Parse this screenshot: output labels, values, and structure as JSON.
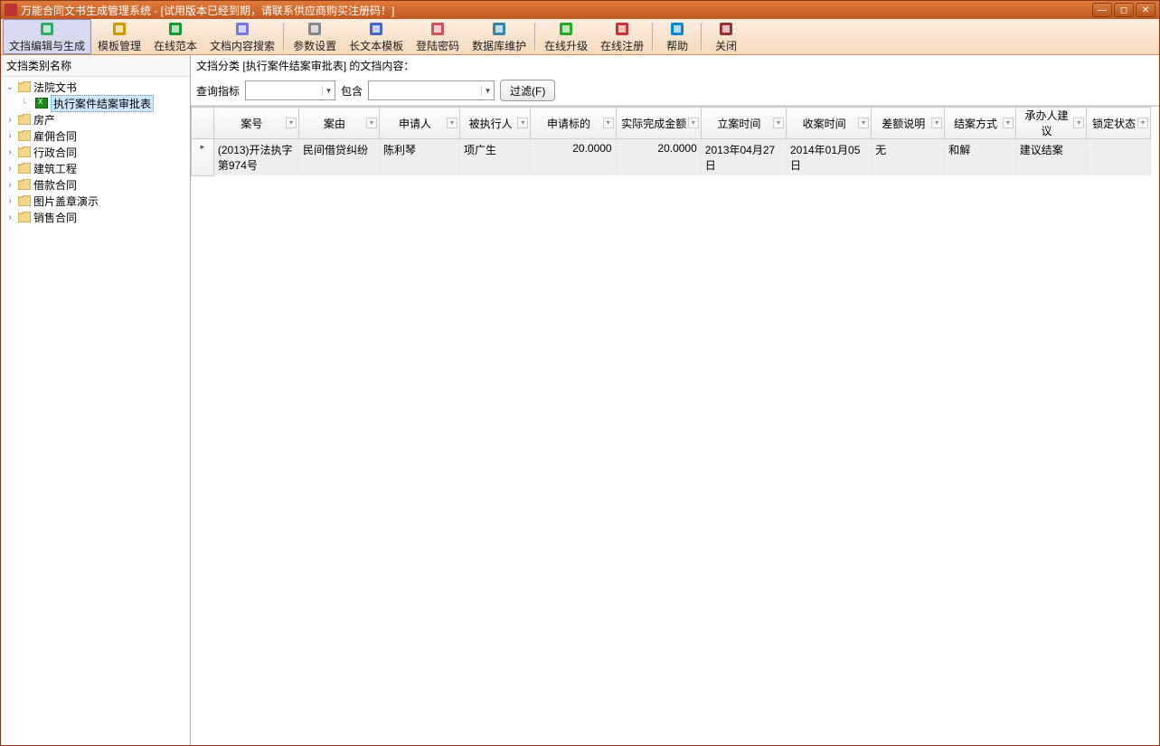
{
  "window": {
    "title": "万能合同文书生成管理系统 - [试用版本已经到期，请联系供应商购买注册码！]"
  },
  "toolbar": {
    "items": [
      {
        "label": "文挡编辑与生成",
        "active": true
      },
      {
        "label": "模板管理"
      },
      {
        "label": "在线范本"
      },
      {
        "label": "文档内容搜索"
      },
      {
        "label": "参数设置"
      },
      {
        "label": "长文本模板"
      },
      {
        "label": "登陆密码"
      },
      {
        "label": "数据库维护"
      },
      {
        "label": "在线升级"
      },
      {
        "label": "在线注册"
      },
      {
        "label": "帮助"
      },
      {
        "label": "关闭"
      }
    ]
  },
  "sidebar": {
    "header": "文挡类别名称",
    "nodes": [
      {
        "label": "法院文书",
        "expanded": true,
        "children": [
          {
            "label": "执行案件结案审批表",
            "selected": true
          }
        ]
      },
      {
        "label": "房产"
      },
      {
        "label": "雇佣合同"
      },
      {
        "label": "行政合同"
      },
      {
        "label": "建筑工程"
      },
      {
        "label": "借款合同"
      },
      {
        "label": "图片盖章演示"
      },
      {
        "label": "销售合同"
      }
    ]
  },
  "main": {
    "header_prefix": "文挡分类",
    "header_category": "[执行案件结案审批表]",
    "header_suffix": "的文挡内容：",
    "filter": {
      "query_label": "查询指标",
      "contain_label": "包含",
      "filter_btn": "过滤(F)"
    }
  },
  "grid": {
    "columns": [
      "案号",
      "案由",
      "申请人",
      "被执行人",
      "申请标的",
      "实际完成金额",
      "立案时间",
      "收案时间",
      "差额说明",
      "结案方式",
      "承办人建议",
      "锁定状态"
    ],
    "rows": [
      {
        "案号": "(2013)开法执字第974号",
        "案由": "民间借贷纠纷",
        "申请人": "陈利琴",
        "被执行人": "项广生",
        "申请标的": "20.0000",
        "实际完成金额": "20.0000",
        "立案时间": "2013年04月27日",
        "收案时间": "2014年01月05日",
        "差额说明": "无",
        "结案方式": "和解",
        "承办人建议": "建议结案",
        "锁定状态": ""
      }
    ]
  }
}
